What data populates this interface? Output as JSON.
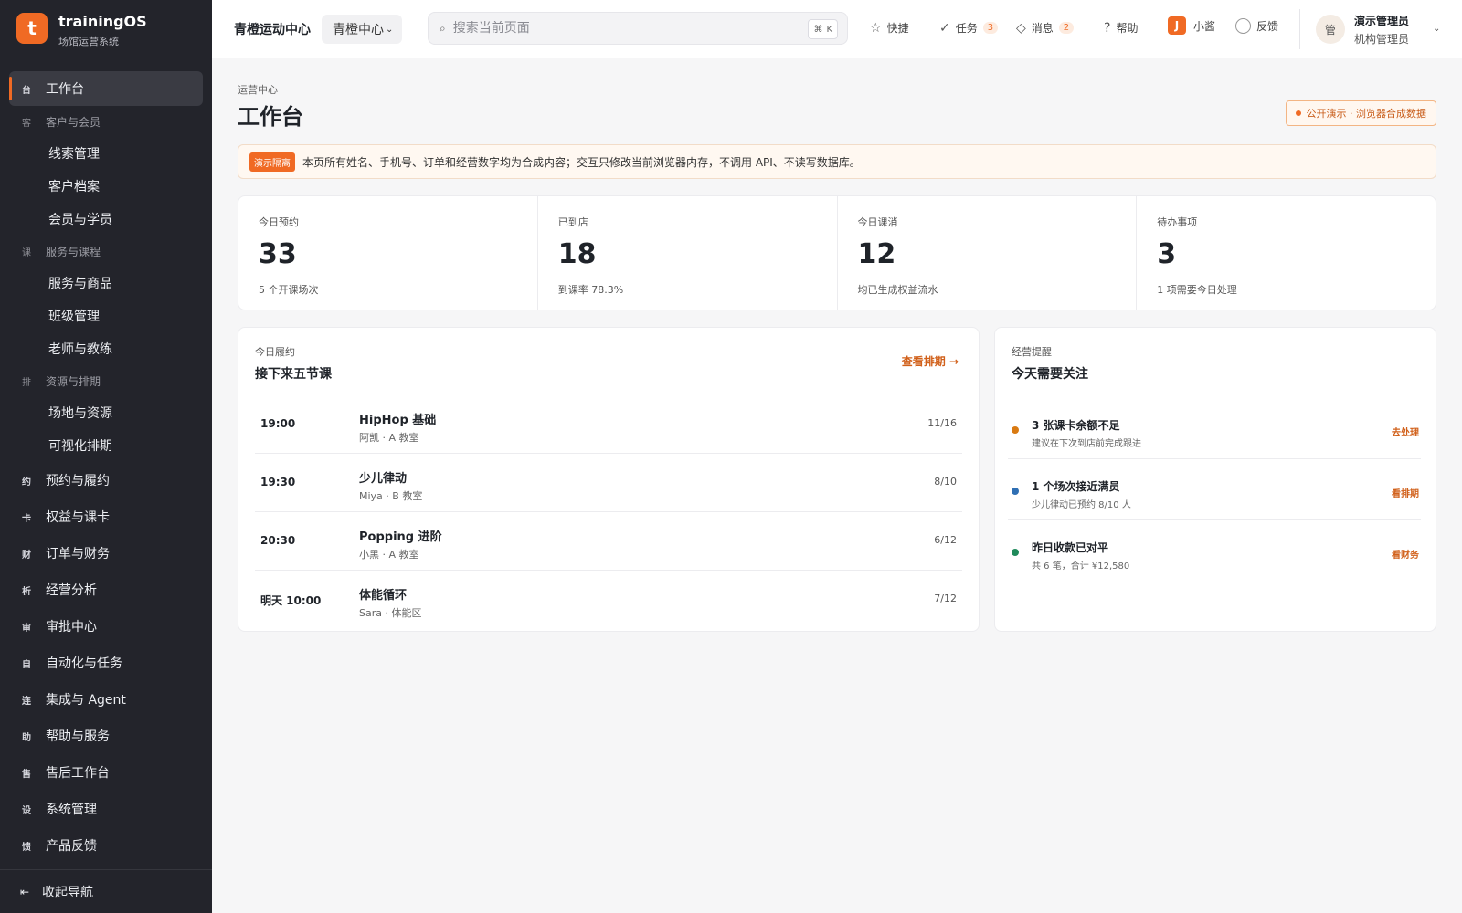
{
  "brand": {
    "logo_letter": "t",
    "name": "trainingOS",
    "subtitle": "场馆运营系统",
    "accent": "#f06a24"
  },
  "sidebar": {
    "items": [
      {
        "kind": "item",
        "icon": "台",
        "label": "工作台",
        "active": true
      },
      {
        "kind": "group",
        "icon": "客",
        "label": "客户与会员"
      },
      {
        "kind": "sub",
        "label": "线索管理"
      },
      {
        "kind": "sub",
        "label": "客户档案"
      },
      {
        "kind": "sub",
        "label": "会员与学员"
      },
      {
        "kind": "group",
        "icon": "课",
        "label": "服务与课程"
      },
      {
        "kind": "sub",
        "label": "服务与商品"
      },
      {
        "kind": "sub",
        "label": "班级管理"
      },
      {
        "kind": "sub",
        "label": "老师与教练"
      },
      {
        "kind": "group",
        "icon": "排",
        "label": "资源与排期"
      },
      {
        "kind": "sub",
        "label": "场地与资源"
      },
      {
        "kind": "sub",
        "label": "可视化排期"
      },
      {
        "kind": "item",
        "icon": "约",
        "label": "预约与履约"
      },
      {
        "kind": "item",
        "icon": "卡",
        "label": "权益与课卡"
      },
      {
        "kind": "item",
        "icon": "财",
        "label": "订单与财务"
      },
      {
        "kind": "item",
        "icon": "析",
        "label": "经营分析"
      },
      {
        "kind": "item",
        "icon": "审",
        "label": "审批中心"
      },
      {
        "kind": "item",
        "icon": "自",
        "label": "自动化与任务"
      },
      {
        "kind": "item",
        "icon": "连",
        "label": "集成与 Agent"
      },
      {
        "kind": "item",
        "icon": "助",
        "label": "帮助与服务"
      },
      {
        "kind": "item",
        "icon": "售",
        "label": "售后工作台"
      },
      {
        "kind": "item",
        "icon": "设",
        "label": "系统管理"
      },
      {
        "kind": "item",
        "icon": "馈",
        "label": "产品反馈"
      }
    ],
    "collapse": {
      "icon": "⇤",
      "label": "收起导航"
    }
  },
  "topbar": {
    "org_name": "青橙运动中心",
    "org_select": "青橙中心",
    "search": {
      "placeholder": "搜索当前页面",
      "shortcut_mod": "⌘",
      "shortcut_key": "K"
    },
    "quick": {
      "icon": "☆",
      "label": "快捷"
    },
    "tasks": {
      "icon": "✓",
      "label": "任务",
      "count": "3"
    },
    "messages": {
      "icon": "◇",
      "label": "消息",
      "count": "2"
    },
    "help": {
      "icon": "?",
      "label": "帮助"
    },
    "assistant": {
      "letter": "J",
      "label": "小酱"
    },
    "feedback": {
      "label": "反馈"
    },
    "user": {
      "avatar": "管",
      "name": "演示管理员",
      "role": "机构管理员"
    }
  },
  "page": {
    "breadcrumb": "运营中心",
    "title": "工作台",
    "demo_tag": "公开演示 · 浏览器合成数据",
    "notice_tag": "演示隔离",
    "notice_text": "本页所有姓名、手机号、订单和经营数字均为合成内容；交互只修改当前浏览器内存，不调用 API、不读写数据库。"
  },
  "stats": [
    {
      "label": "今日预约",
      "value": "33",
      "sub": "5 个开课场次"
    },
    {
      "label": "已到店",
      "value": "18",
      "sub": "到课率 78.3%"
    },
    {
      "label": "今日课消",
      "value": "12",
      "sub": "均已生成权益流水"
    },
    {
      "label": "待办事项",
      "value": "3",
      "sub": "1 项需要今日处理"
    }
  ],
  "schedule": {
    "subtitle": "今日履约",
    "title": "接下来五节课",
    "link": "查看排期 →",
    "rows": [
      {
        "time": "19:00",
        "name": "HipHop 基础",
        "meta": "阿凯 · A 教室",
        "capacity": "11/16"
      },
      {
        "time": "19:30",
        "name": "少儿律动",
        "meta": "Miya · B 教室",
        "capacity": "8/10"
      },
      {
        "time": "20:30",
        "name": "Popping 进阶",
        "meta": "小黑 · A 教室",
        "capacity": "6/12"
      },
      {
        "time": "明天 10:00",
        "name": "体能循环",
        "meta": "Sara · 体能区",
        "capacity": "7/12"
      }
    ]
  },
  "alerts": {
    "subtitle": "经营提醒",
    "title": "今天需要关注",
    "rows": [
      {
        "color": "#d97a12",
        "title": "3 张课卡余额不足",
        "desc": "建议在下次到店前完成跟进",
        "action": "去处理"
      },
      {
        "color": "#2f6fb3",
        "title": "1 个场次接近满员",
        "desc": "少儿律动已预约 8/10 人",
        "action": "看排期"
      },
      {
        "color": "#1f8a5b",
        "title": "昨日收款已对平",
        "desc": "共 6 笔，合计 ¥12,580",
        "action": "看财务"
      }
    ]
  }
}
